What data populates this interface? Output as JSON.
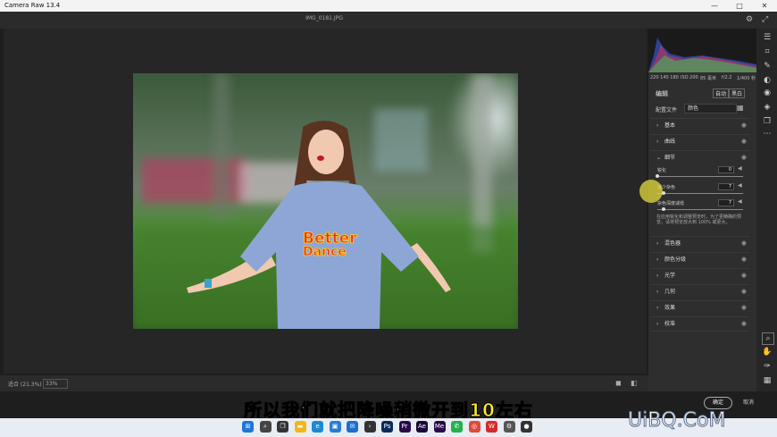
{
  "app": {
    "title": "Camera Raw 13.4",
    "filename": "IMG_0181.JPG"
  },
  "window_controls": {
    "minimize": "—",
    "maximize": "□",
    "close": "✕"
  },
  "top_icons": {
    "settings": "⚙",
    "fullscreen": "⤢"
  },
  "histogram_info": {
    "rgb": "220 140 180",
    "iso": "ISO 200",
    "focal": "85 毫米",
    "aperture": "f/2.2",
    "shutter": "1/400 秒"
  },
  "edit_panel": {
    "title": "编辑",
    "auto_btn": "自动",
    "bw_btn": "黑白",
    "profile_label": "配置文件",
    "profile_value": "颜色",
    "sections_top": [
      {
        "label": "基本",
        "expanded": false
      },
      {
        "label": "曲线",
        "expanded": false
      },
      {
        "label": "细节",
        "expanded": true
      }
    ],
    "detail": {
      "sharpen_label": "锐化",
      "sharpen_value": "0",
      "sharpen_fraction": 0.0,
      "noise_label": "减少杂色",
      "noise_value": "7",
      "noise_fraction": 0.07,
      "color_noise_label": "杂色深度减低",
      "color_noise_value": "7",
      "color_noise_fraction": 0.07,
      "note": "在应用锐化和调整预览时，为了更精确的预览，请将预览放大到 100% 或更大。"
    },
    "sections_bottom": [
      "混色器",
      "颜色分级",
      "光学",
      "几何",
      "效果",
      "校准"
    ]
  },
  "bottom_bar": {
    "fit_label": "适合 (21.3%)",
    "zoom_value": "33%"
  },
  "footer": {
    "ok": "确定",
    "cancel": "取消"
  },
  "caption": "所以我们就把降噪稍微开到10左右",
  "watermark": "UiBQ.CoM",
  "shirt_text": {
    "line1": "Better",
    "line2": "Dance"
  },
  "taskbar_icons": [
    "windows-start",
    "search",
    "task-view",
    "file-explorer",
    "edge",
    "store",
    "mail",
    "terminal",
    "photoshop",
    "premiere",
    "after-effects",
    "media-encoder",
    "wechat",
    "chrome",
    "wps",
    "settings",
    "obs"
  ]
}
